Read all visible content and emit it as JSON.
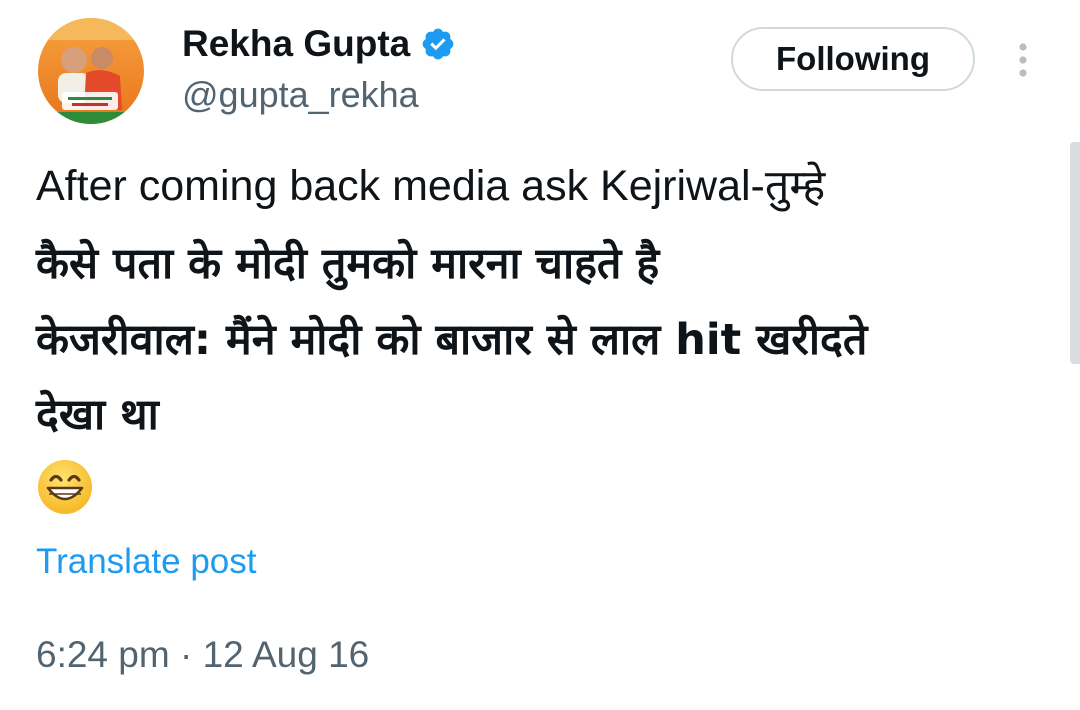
{
  "header": {
    "display_name": "Rekha Gupta",
    "handle": "@gupta_rekha",
    "verified_icon": "verified-badge-icon",
    "follow_label": "Following",
    "more_icon": "more-vertical-icon"
  },
  "tweet": {
    "line1": "After coming back media ask Kejriwal-तुम्हे",
    "line2": "कैसे पता के मोदी तुमको मारना चाहते है",
    "line3": "केजरीवाल: मैंने मोदी को बाजार से लाल hit खरीदते",
    "line4": "देखा था",
    "emoji_icon": "grinning-face-icon"
  },
  "translate_label": "Translate post",
  "meta": {
    "time": "6:24 pm",
    "separator": " · ",
    "date": "12 Aug 16"
  },
  "colors": {
    "accent": "#1d9bf0",
    "text": "#0f1419",
    "secondary": "#536471",
    "border": "#cfd9de"
  }
}
